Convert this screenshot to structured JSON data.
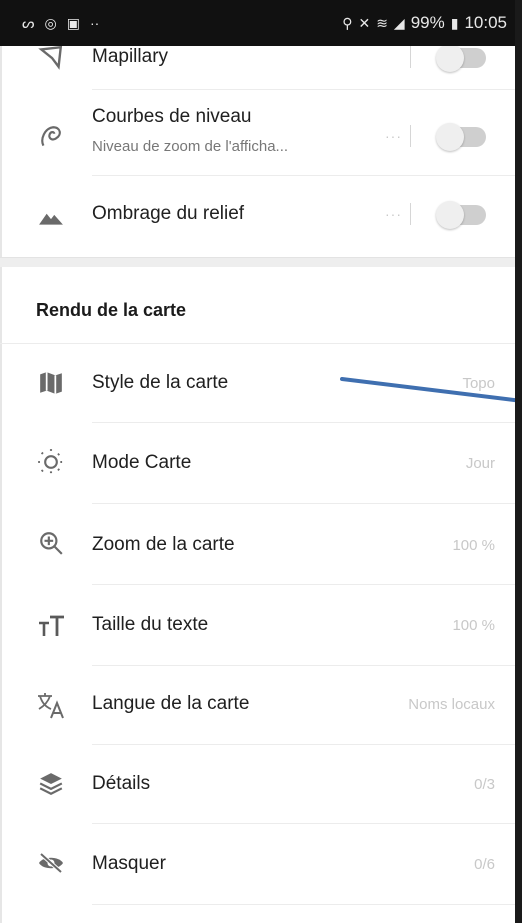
{
  "status_bar": {
    "left_icons": [
      "nfc-icon",
      "whatsapp-icon",
      "gallery-icon",
      "more-dots-icon"
    ],
    "battery": "99%",
    "time": "10:05"
  },
  "layers": {
    "partial_item": {
      "label": "Mapillary"
    },
    "items": [
      {
        "label": "Courbes de niveau",
        "sublabel": "Niveau de zoom de l'afficha...",
        "more": "···",
        "enabled": false
      },
      {
        "label": "Ombrage du relief",
        "more": "···",
        "enabled": false
      }
    ]
  },
  "section": {
    "title": "Rendu de la carte"
  },
  "render_items": [
    {
      "label": "Style de la carte",
      "value": "Topo",
      "icon": "map-icon"
    },
    {
      "label": "Mode Carte",
      "value": "Jour",
      "icon": "sun-icon"
    },
    {
      "label": "Zoom de la carte",
      "value": "100 %",
      "icon": "zoom-in-icon"
    },
    {
      "label": "Taille du texte",
      "value": "100 %",
      "icon": "text-size-icon"
    },
    {
      "label": "Langue de la carte",
      "value": "Noms locaux",
      "icon": "translate-icon"
    },
    {
      "label": "Détails",
      "value": "0/3",
      "icon": "layers-icon"
    },
    {
      "label": "Masquer",
      "value": "0/6",
      "icon": "hide-icon"
    }
  ],
  "annotation": {
    "color": "#3f6fb0"
  }
}
